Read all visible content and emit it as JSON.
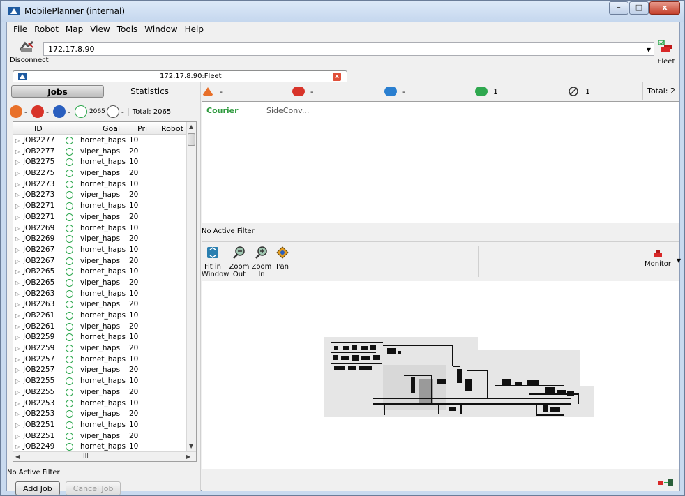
{
  "window": {
    "title": "MobilePlanner (internal)",
    "buttons": {
      "minimize": "–",
      "maximize": "□",
      "close": "x"
    }
  },
  "menu": [
    "File",
    "Robot",
    "Map",
    "View",
    "Tools",
    "Window",
    "Help"
  ],
  "toolbar": {
    "disconnect_label": "Disconnect",
    "address_value": "172.17.8.90",
    "fleet_label": "Fleet"
  },
  "tab": {
    "label": "172.17.8.90:Fleet",
    "close": "x"
  },
  "left": {
    "seg_jobs": "Jobs",
    "seg_stats": "Statistics",
    "status": {
      "error": "-",
      "failed": "-",
      "inprogress": "-",
      "pending": "2065",
      "completed": "-",
      "total": "Total: 2065"
    },
    "columns": [
      "ID",
      "Goal",
      "Pri",
      "Robot"
    ],
    "jobs": [
      {
        "id": "JOB2277",
        "goal": "hornet_haps",
        "pri": "10"
      },
      {
        "id": "JOB2277",
        "goal": "viper_haps",
        "pri": "20"
      },
      {
        "id": "JOB2275",
        "goal": "hornet_haps",
        "pri": "10"
      },
      {
        "id": "JOB2275",
        "goal": "viper_haps",
        "pri": "20"
      },
      {
        "id": "JOB2273",
        "goal": "hornet_haps",
        "pri": "10"
      },
      {
        "id": "JOB2273",
        "goal": "viper_haps",
        "pri": "20"
      },
      {
        "id": "JOB2271",
        "goal": "hornet_haps",
        "pri": "10"
      },
      {
        "id": "JOB2271",
        "goal": "viper_haps",
        "pri": "20"
      },
      {
        "id": "JOB2269",
        "goal": "hornet_haps",
        "pri": "10"
      },
      {
        "id": "JOB2269",
        "goal": "viper_haps",
        "pri": "20"
      },
      {
        "id": "JOB2267",
        "goal": "hornet_haps",
        "pri": "10"
      },
      {
        "id": "JOB2267",
        "goal": "viper_haps",
        "pri": "20"
      },
      {
        "id": "JOB2265",
        "goal": "hornet_haps",
        "pri": "10"
      },
      {
        "id": "JOB2265",
        "goal": "viper_haps",
        "pri": "20"
      },
      {
        "id": "JOB2263",
        "goal": "hornet_haps",
        "pri": "10"
      },
      {
        "id": "JOB2263",
        "goal": "viper_haps",
        "pri": "20"
      },
      {
        "id": "JOB2261",
        "goal": "hornet_haps",
        "pri": "10"
      },
      {
        "id": "JOB2261",
        "goal": "viper_haps",
        "pri": "20"
      },
      {
        "id": "JOB2259",
        "goal": "hornet_haps",
        "pri": "10"
      },
      {
        "id": "JOB2259",
        "goal": "viper_haps",
        "pri": "20"
      },
      {
        "id": "JOB2257",
        "goal": "hornet_haps",
        "pri": "10"
      },
      {
        "id": "JOB2257",
        "goal": "viper_haps",
        "pri": "20"
      },
      {
        "id": "JOB2255",
        "goal": "hornet_haps",
        "pri": "10"
      },
      {
        "id": "JOB2255",
        "goal": "viper_haps",
        "pri": "20"
      },
      {
        "id": "JOB2253",
        "goal": "hornet_haps",
        "pri": "10"
      },
      {
        "id": "JOB2253",
        "goal": "viper_haps",
        "pri": "20"
      },
      {
        "id": "JOB2251",
        "goal": "hornet_haps",
        "pri": "10"
      },
      {
        "id": "JOB2251",
        "goal": "viper_haps",
        "pri": "20"
      },
      {
        "id": "JOB2249",
        "goal": "hornet_haps",
        "pri": "10"
      }
    ],
    "hscroll_thumb": "III",
    "filter_label": "No Active Filter",
    "add_job": "Add Job",
    "cancel_job": "Cancel Job"
  },
  "right": {
    "summary": [
      {
        "name": "unavailable",
        "value": "-",
        "color": "#e8702a"
      },
      {
        "name": "estop",
        "value": "-",
        "color": "#d8342a"
      },
      {
        "name": "docked",
        "value": "-",
        "color": "#2a7fd0"
      },
      {
        "name": "available",
        "value": "1",
        "color": "#2fa84f"
      },
      {
        "name": "not-in-use",
        "value": "1",
        "color": "#333333"
      }
    ],
    "total": "Total: 2",
    "robots": [
      "Courier",
      "SideConv..."
    ],
    "filter_label": "No Active Filter",
    "map_tools": [
      {
        "label1": "Fit in",
        "label2": "Window"
      },
      {
        "label1": "Zoom",
        "label2": "Out"
      },
      {
        "label1": "Zoom",
        "label2": "In"
      },
      {
        "label1": "Pan",
        "label2": ""
      }
    ],
    "monitor_label": "Monitor"
  }
}
